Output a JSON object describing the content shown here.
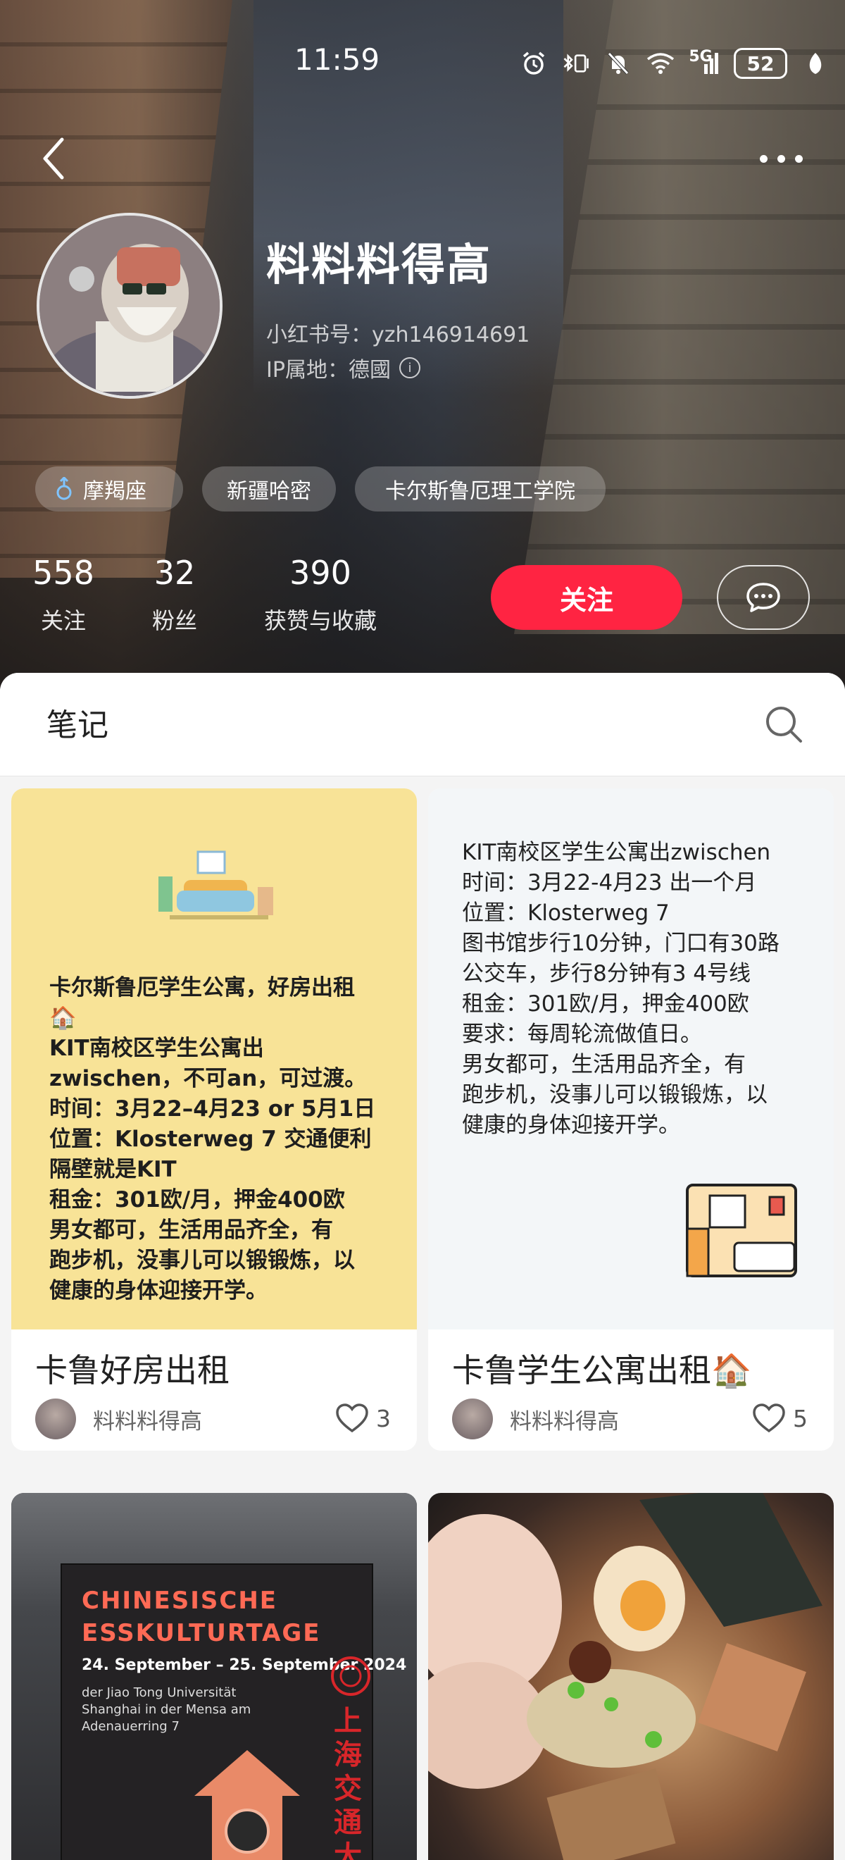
{
  "status_bar": {
    "time": "11:59",
    "battery": "52",
    "network": "5G",
    "icons": [
      "alarm-icon",
      "bluetooth-icon",
      "vibrate-icon",
      "mute-icon",
      "wifi-icon",
      "signal-icon",
      "battery-icon",
      "leaf-icon"
    ]
  },
  "profile": {
    "nickname": "料料料得高",
    "redbook_id": "小红书号：yzh146914691",
    "ip_location": "IP属地：德國",
    "tags": [
      {
        "label": "摩羯座",
        "icon": "female-icon"
      },
      {
        "label": "新疆哈密"
      },
      {
        "label": "卡尔斯鲁厄理工学院"
      }
    ],
    "stats": [
      {
        "value": "558",
        "label": "关注"
      },
      {
        "value": "32",
        "label": "粉丝"
      },
      {
        "value": "390",
        "label": "获赞与收藏"
      }
    ],
    "follow_label": "关注"
  },
  "tabs": {
    "notes_label": "笔记"
  },
  "notes": [
    {
      "title": "卡鲁好房出租",
      "author": "料料料得高",
      "likes": "3",
      "cover_lines": [
        "卡尔斯鲁厄学生公寓，好房出租",
        "🏠",
        "KIT南校区学生公寓出",
        "zwischen，不可an，可过渡。",
        "时间：3月22–4月23 or 5月1日",
        "位置：Klosterweg 7 交通便利",
        "隔壁就是KIT",
        "租金：301欧/月，押金400欧",
        "男女都可，生活用品齐全，有",
        "跑步机，没事儿可以锻锻炼，以",
        "健康的身体迎接开学。"
      ],
      "colors": {
        "cover_bg": "#f8e397"
      }
    },
    {
      "title": "卡鲁学生公寓出租🏠",
      "author": "料料料得高",
      "likes": "5",
      "cover_lines": [
        "KIT南校区学生公寓出zwischen",
        "时间：3月22-4月23 出一个月",
        "位置：Klosterweg 7",
        "图书馆步行10分钟，门口有30路",
        "公交车，步行8分钟有3 4号线",
        "租金：301欧/月，押金400欧",
        "要求：每周轮流做值日。",
        "男女都可，生活用品齐全，有",
        "跑步机，没事儿可以锻锻炼，以",
        "健康的身体迎接开学。"
      ],
      "colors": {
        "cover_bg": "#f3f6f8"
      }
    },
    {
      "poster_title_1": "CHINESISCHE",
      "poster_title_2": "ESSKULTURTAGE",
      "poster_date": "24. September – 25. September 2024",
      "poster_small": "der Jiao Tong Universität Shanghai in der Mensa am Adenauerring 7",
      "poster_vertical": "上海交通大学"
    },
    {
      "image": "ramen-photo"
    }
  ],
  "colors": {
    "brand_red": "#ff2442",
    "text_dark": "#222222",
    "text_muted": "#666666"
  }
}
